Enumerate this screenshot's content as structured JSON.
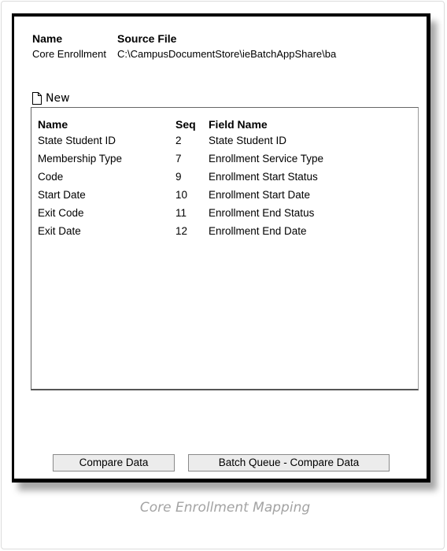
{
  "header": {
    "name_label": "Name",
    "source_label": "Source File",
    "name_value": "Core Enrollment",
    "source_value": "C:\\CampusDocumentStore\\ieBatchAppShare\\ba"
  },
  "toolbar": {
    "new_label": "New",
    "new_icon": "new-document-icon"
  },
  "mapping_table": {
    "columns": [
      "Name",
      "Seq",
      "Field Name"
    ],
    "rows": [
      {
        "name": "State Student ID",
        "seq": "2",
        "field": "State Student ID"
      },
      {
        "name": "Membership Type",
        "seq": "7",
        "field": "Enrollment Service Type"
      },
      {
        "name": "Code",
        "seq": "9",
        "field": "Enrollment Start Status"
      },
      {
        "name": "Start Date",
        "seq": "10",
        "field": "Enrollment Start Date"
      },
      {
        "name": "Exit Code",
        "seq": "11",
        "field": "Enrollment End Status"
      },
      {
        "name": "Exit Date",
        "seq": "12",
        "field": "Enrollment End Date"
      }
    ]
  },
  "buttons": {
    "compare": "Compare Data",
    "batch_compare": "Batch Queue - Compare Data"
  },
  "caption": "Core Enrollment Mapping",
  "colors": {
    "panel_border": "#000000",
    "button_bg": "#ececec",
    "caption": "#a3a3a3"
  }
}
